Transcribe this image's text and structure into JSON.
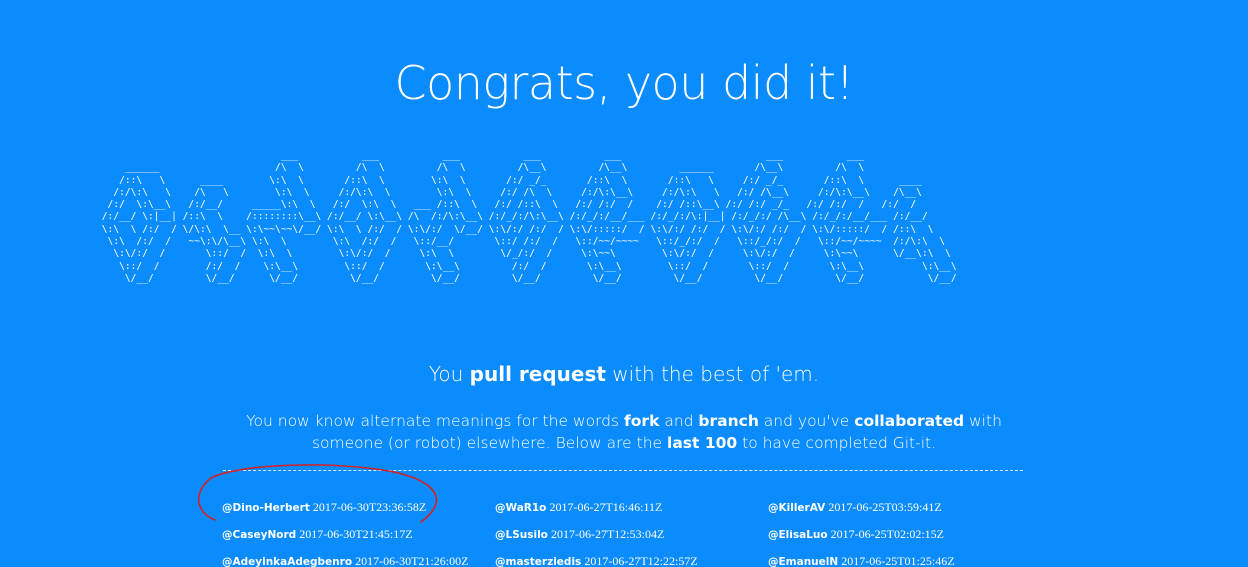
{
  "page": {
    "title": "Congrats, you did it!",
    "ascii_art": "                                ___           ___           ___           ___           ___                         ___           ___\n     ______                    /\\  \\         /\\  \\         /\\  \\         /\\__\\         /\\__\\         ______       /\\__\\         /\\  \\\n    /::\\   \\      ____        \\:\\  \\       /::\\  \\        \\:\\  \\       /:/ _/_       /::\\  \\       /::\\   \\     /:/ _/_       /::\\  \\      ____\n   /:/\\:\\   \\    /\\   \\        \\:\\  \\     /:/\\:\\  \\        \\:\\  \\     /:/ /\\  \\     /:/\\:\\__\\     /:/\\:\\   \\   /:/ /\\__\\     /:/\\:\\__\\    /\\__\\\n  /:/  \\:\\__\\   /:/__/     _____\\:\\  \\   /:/  \\:\\  \\   ___ /::\\  \\   /:/ /::\\  \\   /:/ /:/  /    /:/ /::\\__\\ /:/ /:/ _/_   /:/ /:/  /   /:/  /\n /:/__/ \\:|__| /::\\  \\    /::::::::\\__\\ /:/__/ \\:\\__\\ /\\  /:/\\:\\__\\ /:/_/:/\\:\\__\\ /:/_/:/__/___ /:/_/:/\\:|__| /:/_/:/ /\\__\\ /:/_/:/__/___ /:/__/\n \\:\\  \\ /:/  / \\/\\:\\  \\__ \\:\\~~\\~~\\/__/ \\:\\  \\ /:/  / \\:\\/:/  \\/__/ \\:\\/:/ /:/  / \\:\\/:::::/  / \\:\\/:/ /:/  / \\:\\/:/ /:/  / \\:\\/:::::/  / /::\\  \\\n  \\:\\  /:/  /   ~~\\:\\/\\__\\ \\:\\  \\        \\:\\  /:/  /   \\::/__/       \\::/ /:/  /   \\::/~~/~~~~   \\::/_/:/  /   \\::/_/:/  /   \\::/~~/~~~~  /:/\\:\\  \\\n   \\:\\/:/  /       \\::/  /  \\:\\  \\        \\:\\/:/  /     \\:\\  \\        \\/_/:/  /     \\:\\~~\\        \\:\\/:/  /     \\:\\/:/  /     \\:\\~~\\      \\/__\\:\\  \\\n    \\::/  /        /:/  /    \\:\\__\\        \\::/  /       \\:\\__\\         /:/  /       \\:\\__\\        \\::/  /       \\::/  /       \\:\\__\\          \\:\\__\\\n     \\/__/         \\/__/      \\/__/         \\/__/         \\/__/         \\/__/         \\/__/         \\/__/         \\/__/         \\/__/           \\/__/",
    "tagline_pre": "You ",
    "tagline_bold": "pull request",
    "tagline_post": " with the best of 'em.",
    "desc": {
      "t1": "You now know alternate meanings for the words ",
      "b1": "fork",
      "t2": " and ",
      "b2": "branch",
      "t3": " and you've ",
      "b3": "collaborated",
      "t4": " with someone (or robot) elsewhere. Below are the ",
      "b4": "last 100",
      "t5": " to have completed Git-it."
    }
  },
  "completers": [
    [
      {
        "user": "@Dino-Herbert",
        "time": "2017-06-30T23:36:58Z"
      },
      {
        "user": "@WaR1o",
        "time": "2017-06-27T16:46:11Z"
      },
      {
        "user": "@KillerAV",
        "time": "2017-06-25T03:59:41Z"
      }
    ],
    [
      {
        "user": "@CaseyNord",
        "time": "2017-06-30T21:45:17Z"
      },
      {
        "user": "@LSusilo",
        "time": "2017-06-27T12:53:04Z"
      },
      {
        "user": "@ElisaLuo",
        "time": "2017-06-25T02:02:15Z"
      }
    ],
    [
      {
        "user": "@AdeyinkaAdegbenro",
        "time": "2017-06-30T21:26:00Z"
      },
      {
        "user": "@masterziedis",
        "time": "2017-06-27T12:22:57Z"
      },
      {
        "user": "@EmanuelN",
        "time": "2017-06-25T01:25:46Z"
      }
    ]
  ],
  "colors": {
    "background": "#0a8cff",
    "text": "#ffffff",
    "annotation": "#d42020"
  }
}
